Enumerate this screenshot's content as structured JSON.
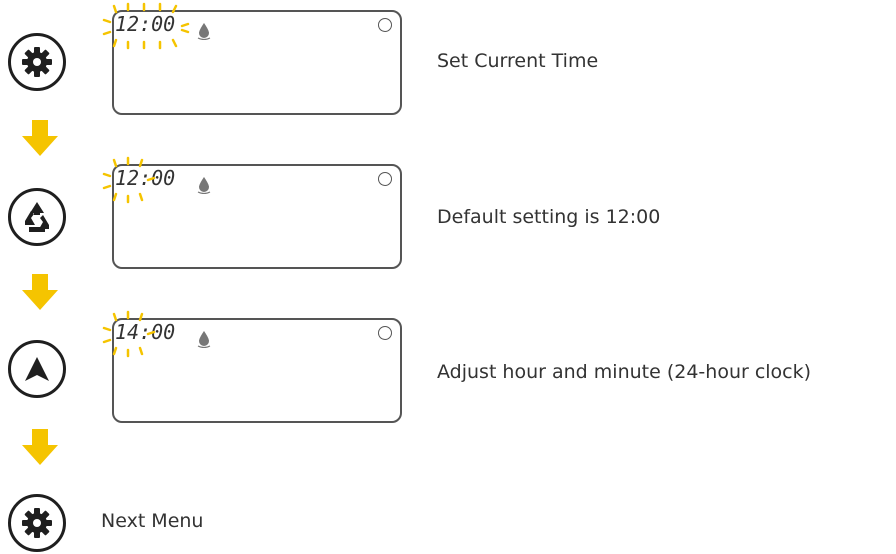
{
  "steps": [
    {
      "button_icon": "gear-icon",
      "display_time": "12:00",
      "flashing": "hours+minutes",
      "caption": "Set Current Time"
    },
    {
      "button_icon": "recycle-icon",
      "display_time": "12:00",
      "flashing": "hours",
      "caption": "Default setting is 12:00"
    },
    {
      "button_icon": "arrow-up-icon",
      "display_time": "14:00",
      "flashing": "hours",
      "caption": "Adjust hour and minute (24-hour clock)"
    }
  ],
  "final": {
    "button_icon": "gear-icon",
    "label": "Next Menu"
  },
  "colors": {
    "flash": "#f5c400",
    "arrow": "#f5c400",
    "outline": "#1f1f1f",
    "lcd_border": "#555555",
    "text": "#333333"
  }
}
